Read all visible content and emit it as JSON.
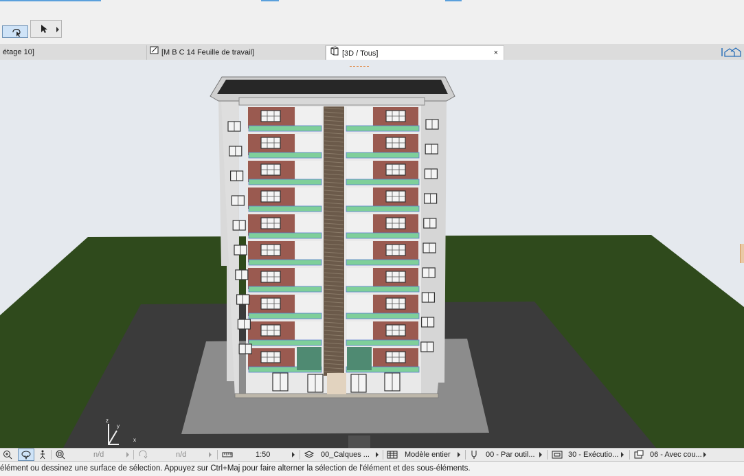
{
  "colors": {
    "accent": "#5aa0dc",
    "ground": "#2f4a1c",
    "asphalt": "#3a3a3a",
    "slab": "#8a8a8a",
    "wall": "#dcdcdc",
    "brick": "#9a5a50",
    "balcony": "#7fcf9a",
    "stair": "#6b5a4a",
    "background": "#e5e9ee"
  },
  "toolbar": {
    "tool_icons": [
      "marquee-select-icon",
      "arrow-pointer-icon"
    ]
  },
  "tabs": [
    {
      "label": "étage 10]",
      "icon": "floor-plan-icon",
      "active": false
    },
    {
      "label": "[M B C 14 Feuille de travail]",
      "icon": "worksheet-icon",
      "active": false
    },
    {
      "label": "[3D / Tous]",
      "icon": "3d-window-icon",
      "active": true,
      "close": "×"
    }
  ],
  "statusbar": {
    "zoom_value": "n/d",
    "rotate_value": "n/d",
    "scale": "1:50",
    "layers": "00_Calques ...",
    "model": "Modèle entier",
    "pen_set": "00 - Par outil...",
    "model_view": "30 - Exécutio...",
    "renovation": "06 - Avec cou..."
  },
  "message": "élément ou dessinez une surface de sélection. Appuyez sur Ctrl+Maj pour faire alterner la sélection de l'élément et des sous-éléments.",
  "axis_labels": {
    "x": "x",
    "y": "y",
    "z": "z"
  }
}
